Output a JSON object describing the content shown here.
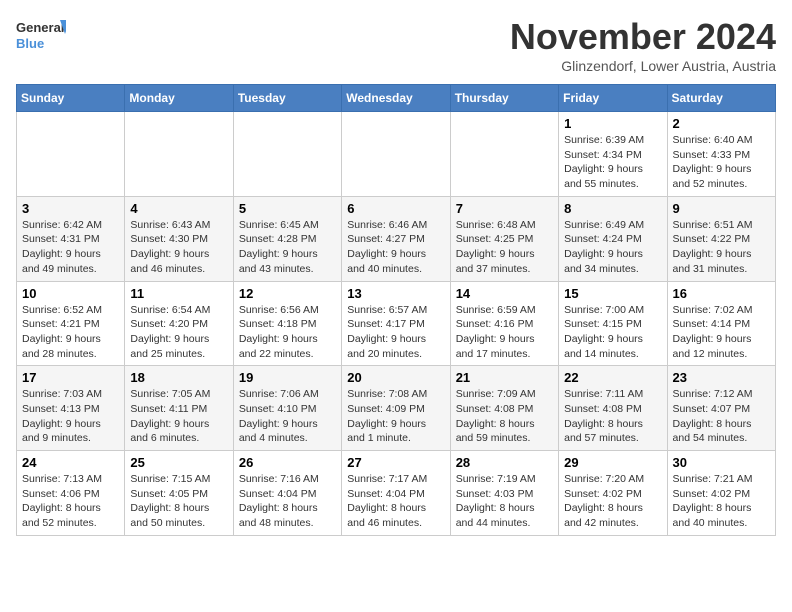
{
  "header": {
    "logo_line1": "General",
    "logo_line2": "Blue",
    "month_title": "November 2024",
    "location": "Glinzendorf, Lower Austria, Austria"
  },
  "weekdays": [
    "Sunday",
    "Monday",
    "Tuesday",
    "Wednesday",
    "Thursday",
    "Friday",
    "Saturday"
  ],
  "weeks": [
    [
      {
        "day": "",
        "info": ""
      },
      {
        "day": "",
        "info": ""
      },
      {
        "day": "",
        "info": ""
      },
      {
        "day": "",
        "info": ""
      },
      {
        "day": "",
        "info": ""
      },
      {
        "day": "1",
        "info": "Sunrise: 6:39 AM\nSunset: 4:34 PM\nDaylight: 9 hours and 55 minutes."
      },
      {
        "day": "2",
        "info": "Sunrise: 6:40 AM\nSunset: 4:33 PM\nDaylight: 9 hours and 52 minutes."
      }
    ],
    [
      {
        "day": "3",
        "info": "Sunrise: 6:42 AM\nSunset: 4:31 PM\nDaylight: 9 hours and 49 minutes."
      },
      {
        "day": "4",
        "info": "Sunrise: 6:43 AM\nSunset: 4:30 PM\nDaylight: 9 hours and 46 minutes."
      },
      {
        "day": "5",
        "info": "Sunrise: 6:45 AM\nSunset: 4:28 PM\nDaylight: 9 hours and 43 minutes."
      },
      {
        "day": "6",
        "info": "Sunrise: 6:46 AM\nSunset: 4:27 PM\nDaylight: 9 hours and 40 minutes."
      },
      {
        "day": "7",
        "info": "Sunrise: 6:48 AM\nSunset: 4:25 PM\nDaylight: 9 hours and 37 minutes."
      },
      {
        "day": "8",
        "info": "Sunrise: 6:49 AM\nSunset: 4:24 PM\nDaylight: 9 hours and 34 minutes."
      },
      {
        "day": "9",
        "info": "Sunrise: 6:51 AM\nSunset: 4:22 PM\nDaylight: 9 hours and 31 minutes."
      }
    ],
    [
      {
        "day": "10",
        "info": "Sunrise: 6:52 AM\nSunset: 4:21 PM\nDaylight: 9 hours and 28 minutes."
      },
      {
        "day": "11",
        "info": "Sunrise: 6:54 AM\nSunset: 4:20 PM\nDaylight: 9 hours and 25 minutes."
      },
      {
        "day": "12",
        "info": "Sunrise: 6:56 AM\nSunset: 4:18 PM\nDaylight: 9 hours and 22 minutes."
      },
      {
        "day": "13",
        "info": "Sunrise: 6:57 AM\nSunset: 4:17 PM\nDaylight: 9 hours and 20 minutes."
      },
      {
        "day": "14",
        "info": "Sunrise: 6:59 AM\nSunset: 4:16 PM\nDaylight: 9 hours and 17 minutes."
      },
      {
        "day": "15",
        "info": "Sunrise: 7:00 AM\nSunset: 4:15 PM\nDaylight: 9 hours and 14 minutes."
      },
      {
        "day": "16",
        "info": "Sunrise: 7:02 AM\nSunset: 4:14 PM\nDaylight: 9 hours and 12 minutes."
      }
    ],
    [
      {
        "day": "17",
        "info": "Sunrise: 7:03 AM\nSunset: 4:13 PM\nDaylight: 9 hours and 9 minutes."
      },
      {
        "day": "18",
        "info": "Sunrise: 7:05 AM\nSunset: 4:11 PM\nDaylight: 9 hours and 6 minutes."
      },
      {
        "day": "19",
        "info": "Sunrise: 7:06 AM\nSunset: 4:10 PM\nDaylight: 9 hours and 4 minutes."
      },
      {
        "day": "20",
        "info": "Sunrise: 7:08 AM\nSunset: 4:09 PM\nDaylight: 9 hours and 1 minute."
      },
      {
        "day": "21",
        "info": "Sunrise: 7:09 AM\nSunset: 4:08 PM\nDaylight: 8 hours and 59 minutes."
      },
      {
        "day": "22",
        "info": "Sunrise: 7:11 AM\nSunset: 4:08 PM\nDaylight: 8 hours and 57 minutes."
      },
      {
        "day": "23",
        "info": "Sunrise: 7:12 AM\nSunset: 4:07 PM\nDaylight: 8 hours and 54 minutes."
      }
    ],
    [
      {
        "day": "24",
        "info": "Sunrise: 7:13 AM\nSunset: 4:06 PM\nDaylight: 8 hours and 52 minutes."
      },
      {
        "day": "25",
        "info": "Sunrise: 7:15 AM\nSunset: 4:05 PM\nDaylight: 8 hours and 50 minutes."
      },
      {
        "day": "26",
        "info": "Sunrise: 7:16 AM\nSunset: 4:04 PM\nDaylight: 8 hours and 48 minutes."
      },
      {
        "day": "27",
        "info": "Sunrise: 7:17 AM\nSunset: 4:04 PM\nDaylight: 8 hours and 46 minutes."
      },
      {
        "day": "28",
        "info": "Sunrise: 7:19 AM\nSunset: 4:03 PM\nDaylight: 8 hours and 44 minutes."
      },
      {
        "day": "29",
        "info": "Sunrise: 7:20 AM\nSunset: 4:02 PM\nDaylight: 8 hours and 42 minutes."
      },
      {
        "day": "30",
        "info": "Sunrise: 7:21 AM\nSunset: 4:02 PM\nDaylight: 8 hours and 40 minutes."
      }
    ]
  ]
}
